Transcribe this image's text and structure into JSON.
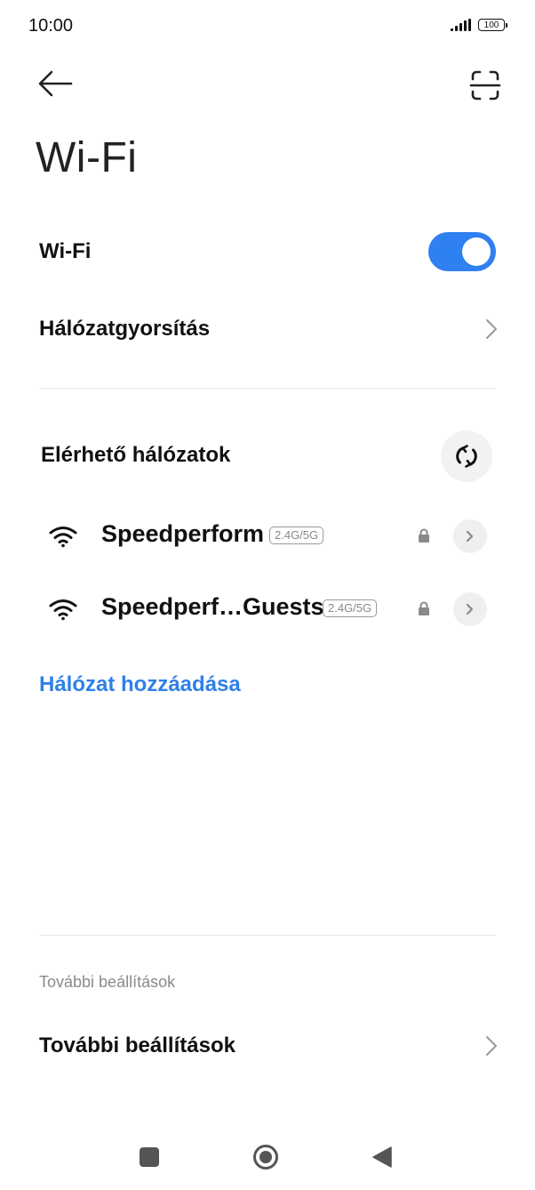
{
  "status_bar": {
    "time": "10:00",
    "battery": "100"
  },
  "header": {
    "back_icon": "arrow-left-icon",
    "scan_icon": "scan-qr-icon",
    "title": "Wi-Fi"
  },
  "wifi_toggle": {
    "label": "Wi-Fi",
    "enabled": true,
    "accent_color": "#2f80f0"
  },
  "network_acceleration": {
    "label": "Hálózatgyorsítás"
  },
  "available_networks": {
    "label": "Elérhető hálózatok",
    "refresh_icon": "refresh-icon",
    "networks": [
      {
        "name": "Speedperform",
        "band": "2.4G/5G",
        "secured": true
      },
      {
        "name": "Speedperf…Guests",
        "band": "2.4G/5G",
        "secured": true
      }
    ]
  },
  "add_network": {
    "label": "Hálózat hozzáadása",
    "color": "#2f80e8"
  },
  "more_settings": {
    "section_header": "További beállítások",
    "label": "További beállítások"
  }
}
